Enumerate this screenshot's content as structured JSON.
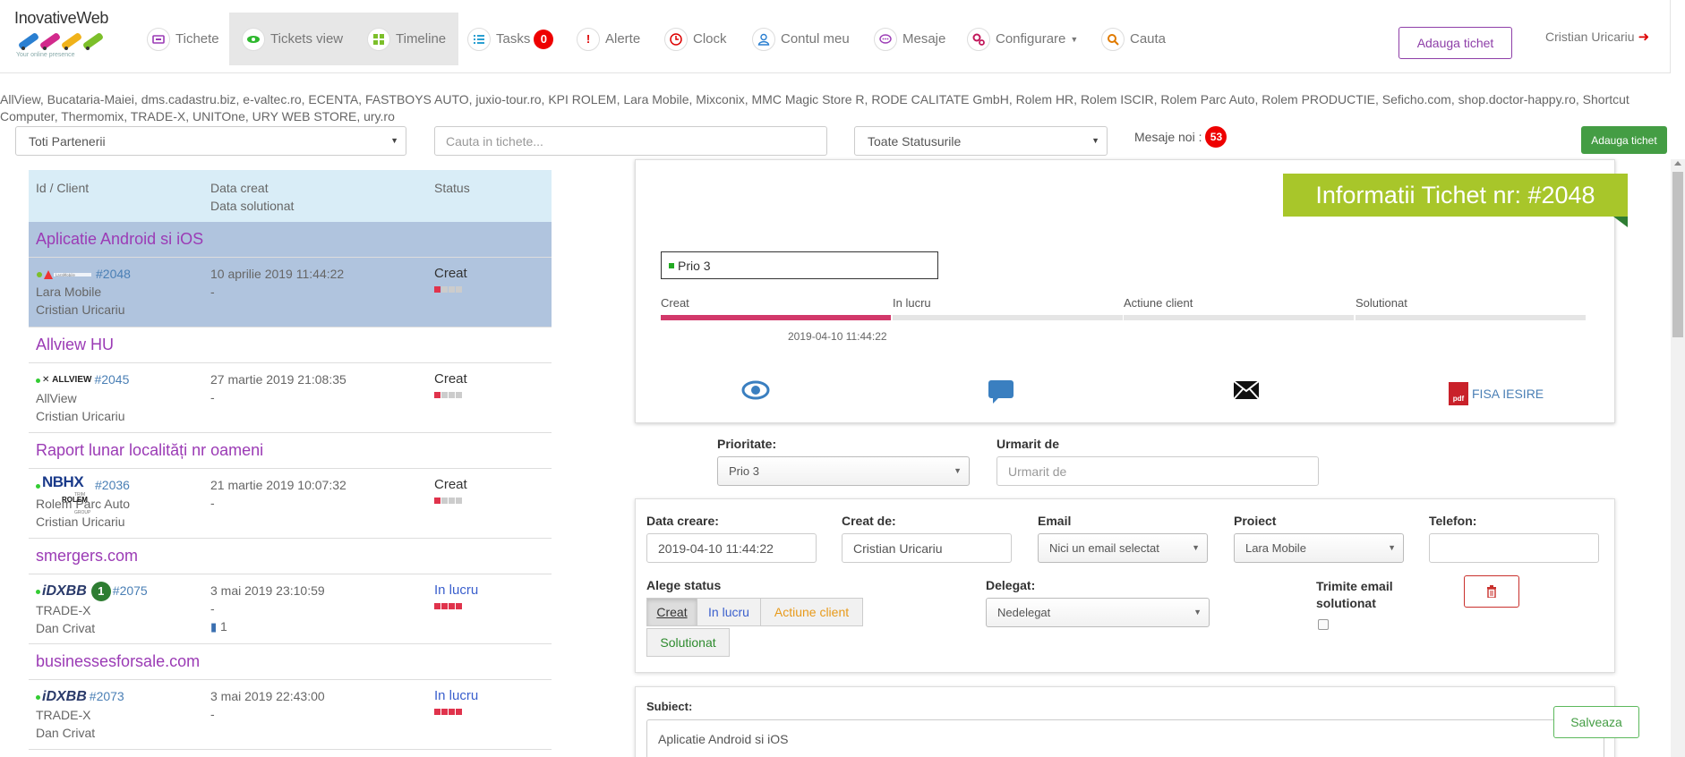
{
  "brand": {
    "name": "InovativeWeb",
    "tagline": "Your online presence"
  },
  "nav": {
    "tichete": "Tichete",
    "tickets_view": "Tickets view",
    "timeline": "Timeline",
    "tasks": "Tasks",
    "tasks_count": "0",
    "alerte": "Alerte",
    "clock": "Clock",
    "contul_meu": "Contul meu",
    "mesaje": "Mesaje",
    "configurare": "Configurare",
    "cauta": "Cauta",
    "add_ticket": "Adauga tichet",
    "user": "Cristian Uricariu"
  },
  "partners_text": "AllView, Bucataria-Maiei, dms.cadastru.biz, e-valtec.ro, ECENTA, FASTBOYS AUTO, juxio-tour.ro, KPI ROLEM, Lara Mobile, Mixconix, MMC Magic Store R, RODE CALITATE GmbH, Rolem HR, Rolem ISCIR, Rolem Parc Auto, Rolem PRODUCTIE, Seficho.com, shop.doctor-happy.ro, Shortcut Computer, Thermomix, TRADE-X, UNITOne, URY WEB STORE, ury.ro",
  "filters": {
    "partners_select": "Toti Partenerii",
    "search_placeholder": "Cauta in tichete...",
    "status_select": "Toate Statusurile",
    "new_messages_label": "Mesaje noi :",
    "new_messages_count": "53",
    "add_ticket": "Adauga tichet"
  },
  "table": {
    "col_id": "Id / Client",
    "col_created": "Data creat",
    "col_solved": "Data solutionat",
    "col_status": "Status"
  },
  "groups": [
    {
      "title": "Aplicatie Android si iOS",
      "id": "#2048",
      "client": "Lara Mobile",
      "user": "Cristian Uricariu",
      "created": "10 aprilie 2019 11:44:22",
      "solved": "-",
      "status": "Creat",
      "logo": "LaraMobile"
    },
    {
      "title": "Allview HU",
      "id": "#2045",
      "client": "AllView",
      "user": "Cristian Uricariu",
      "created": "27 martie 2019 21:08:35",
      "solved": "-",
      "status": "Creat",
      "logo": "ALLVIEW"
    },
    {
      "title": "Raport lunar localități nr oameni",
      "id": "#2036",
      "client": "Rolem Parc Auto",
      "user": "Cristian Uricariu",
      "created": "21 martie 2019 10:07:32",
      "solved": "-",
      "status": "Creat",
      "logo": "NBHX",
      "logo_sub": "TRIM GROUP",
      "logo_sub2": "ROLEM"
    },
    {
      "title": "smergers.com",
      "id": "#2075",
      "client": "TRADE-X",
      "user": "Dan Crivat",
      "created": "3 mai 2019 23:10:59",
      "solved": "-",
      "status": "In lucru",
      "logo": "iDXBB",
      "badge": "1",
      "files": "1"
    },
    {
      "title": "businessesforsale.com",
      "id": "#2073",
      "client": "TRADE-X",
      "user": "Dan Crivat",
      "created": "3 mai 2019 22:43:00",
      "solved": "-",
      "status": "In lucru",
      "logo": "iDXBB"
    }
  ],
  "info": {
    "title": "Informatii Tichet nr: #2048",
    "priority_label": "Prio 3",
    "steps": [
      "Creat",
      "In lucru",
      "Actiune client",
      "Solutionat"
    ],
    "step_date": "2019-04-10 11:44:22",
    "fisa": "FISA IESIRE",
    "pdf": "pdf"
  },
  "form": {
    "prioritate_label": "Prioritate:",
    "prioritate_value": "Prio 3",
    "urmarit_label": "Urmarit de",
    "urmarit_placeholder": "Urmarit de",
    "data_creare_label": "Data creare:",
    "data_creare_value": "2019-04-10 11:44:22",
    "creat_de_label": "Creat de:",
    "creat_de_value": "Cristian Uricariu",
    "email_label": "Email",
    "email_value": "Nici un email selectat",
    "proiect_label": "Proiect",
    "proiect_value": "Lara Mobile",
    "telefon_label": "Telefon:",
    "alege_status_label": "Alege status",
    "status_creat": "Creat",
    "status_lucru": "In lucru",
    "status_actiune": "Actiune client",
    "status_solutionat": "Solutionat",
    "delegat_label": "Delegat:",
    "delegat_value": "Nedelegat",
    "trimite_email_label": "Trimite email",
    "trimite_email_label2": "solutionat",
    "subiect_label": "Subiect:",
    "subiect_value": "Aplicatie Android si iOS",
    "save": "Salveaza"
  }
}
